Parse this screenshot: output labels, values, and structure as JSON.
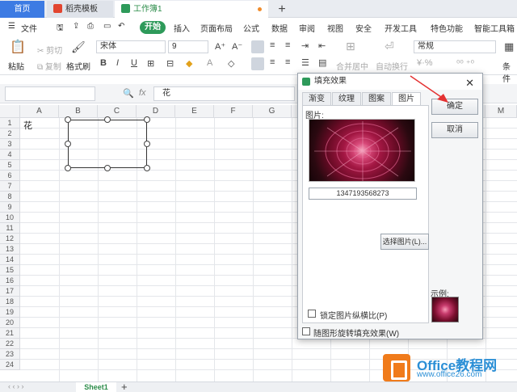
{
  "tabs": {
    "home": "首页",
    "template": "稻壳模板",
    "workbook": "工作簿1",
    "add": "+"
  },
  "menu": {
    "file": "文件",
    "start": "开始",
    "insert": "插入",
    "page_layout": "页面布局",
    "formula": "公式",
    "data": "数据",
    "review": "审阅",
    "view": "视图",
    "security": "安全",
    "dev_tools": "开发工具",
    "special": "特色功能",
    "smart_toolbox": "智能工具箱"
  },
  "ribbon": {
    "paste": "粘贴",
    "cut": "剪切",
    "copy": "复制",
    "format_painter": "格式刷",
    "font_name": "宋体",
    "font_size": "9",
    "merge_center": "合并居中",
    "auto_wrap": "自动换行",
    "number_format": "常规",
    "condition": "条件"
  },
  "formula_bar": {
    "fx": "fx",
    "content": "花"
  },
  "grid": {
    "columns": [
      "A",
      "B",
      "C",
      "D",
      "E",
      "F",
      "G",
      "H",
      "I",
      "J",
      "K",
      "L",
      "M"
    ],
    "rows": [
      "1",
      "2",
      "3",
      "4",
      "5",
      "6",
      "7",
      "8",
      "9",
      "10",
      "11",
      "12",
      "13",
      "14",
      "15",
      "16",
      "17",
      "18",
      "19",
      "20",
      "21",
      "22",
      "23",
      "24"
    ],
    "a1": "花"
  },
  "sheet": {
    "name": "Sheet1",
    "add": "+"
  },
  "dialog": {
    "title": "填充效果",
    "tabs": [
      "渐变",
      "纹理",
      "图案",
      "图片"
    ],
    "image_label": "图片:",
    "image_name": "1347193568273",
    "select_image": "选择图片(L)...",
    "lock_aspect": "锁定图片纵横比(P)",
    "rotate_with_shape": "随图形旋转填充效果(W)",
    "ok": "确定",
    "cancel": "取消",
    "preview_label": "示例:"
  },
  "watermark": {
    "title": "Office教程网",
    "url": "www.office26.com"
  }
}
